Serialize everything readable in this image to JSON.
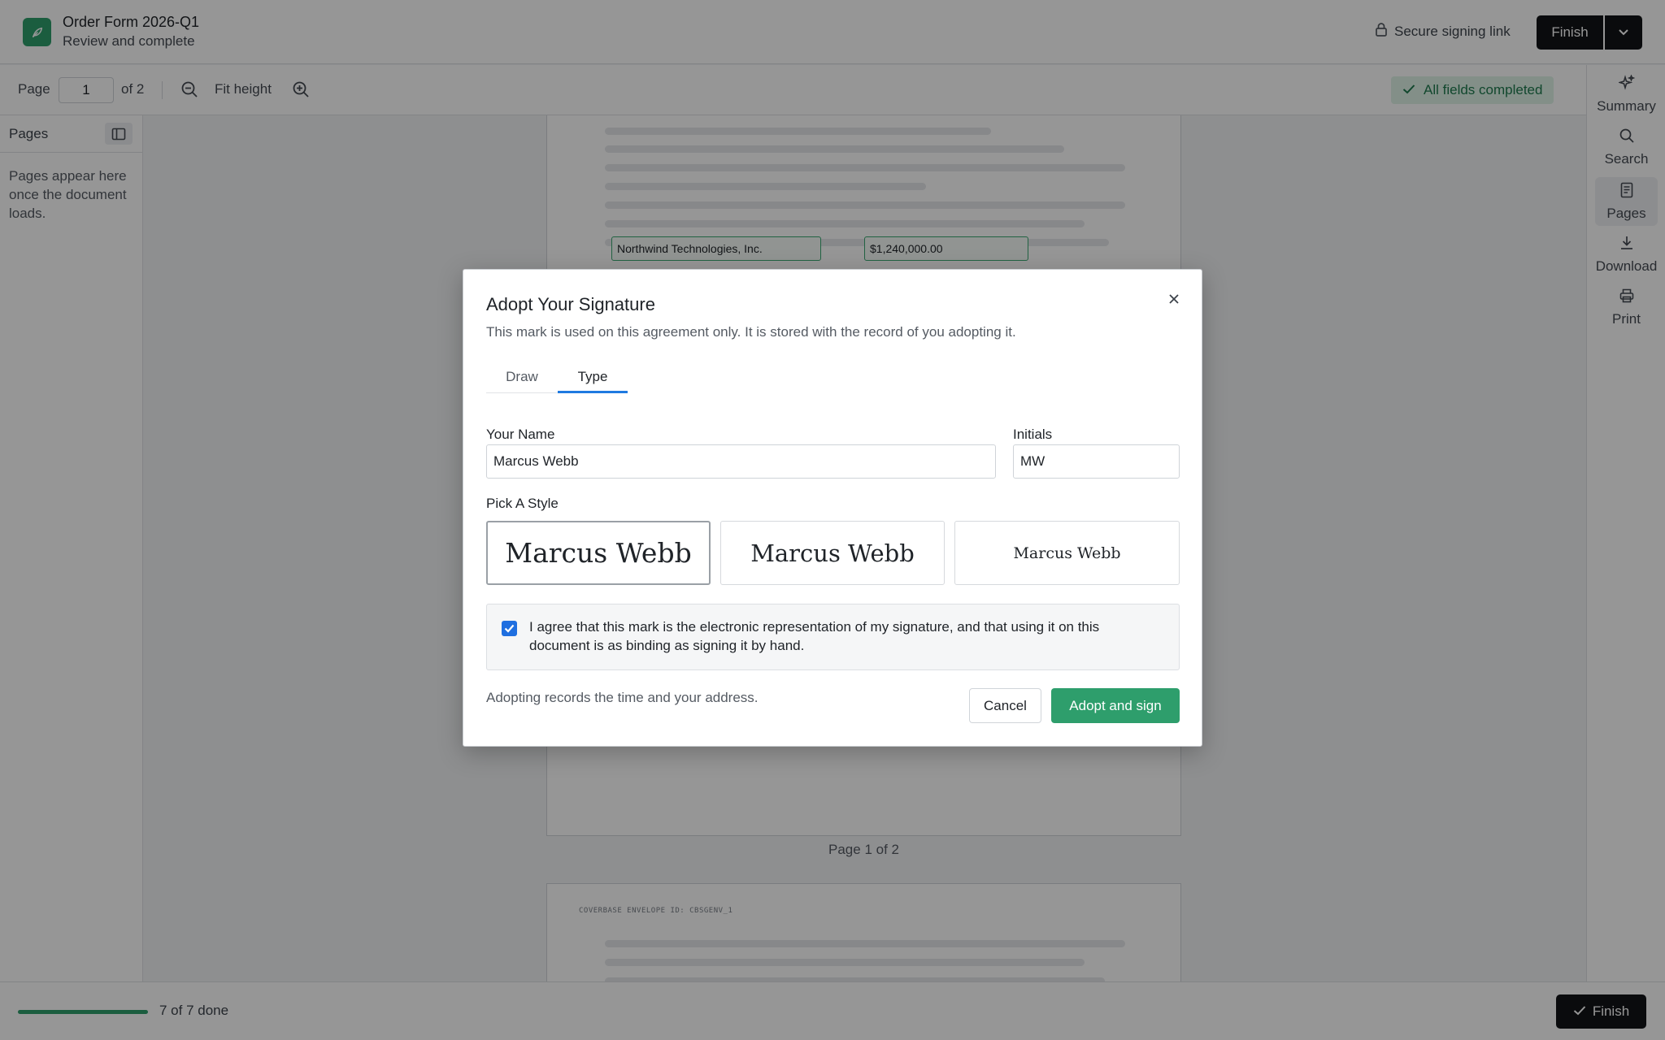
{
  "header": {
    "doc_title": "Order Form 2026-Q1",
    "doc_subtitle": "Review and complete",
    "secure_label": "Secure signing link",
    "finish_label": "Finish",
    "logo_icon": "leaf-icon",
    "brand_color": "#2e9e6c"
  },
  "toolbar": {
    "page_label": "Page",
    "page_value": "1",
    "page_of": "of 2",
    "zoom_label": "Fit height",
    "status": "All fields completed",
    "status_color": "#1d7a4d"
  },
  "rail": {
    "items": [
      {
        "label": "Summary",
        "icon": "sparkle-icon"
      },
      {
        "label": "Search",
        "icon": "search-icon"
      },
      {
        "label": "Pages",
        "icon": "page-icon",
        "active": true
      },
      {
        "label": "Download",
        "icon": "download-icon"
      },
      {
        "label": "Print",
        "icon": "printer-icon"
      }
    ]
  },
  "left_panel": {
    "title": "Pages",
    "empty_text": "Pages appear here once the document loads."
  },
  "document": {
    "fields": [
      "Northwind Technologies, Inc.",
      "$1,240,000.00"
    ],
    "page_caption": "Page 1 of 2",
    "envelope_id": "COVERBASE ENVELOPE ID: CBSGENV_1"
  },
  "bottom": {
    "progress_text": "7 of 7 done",
    "progress_fraction": 1.0,
    "finish_label": "Finish"
  },
  "modal": {
    "title": "Adopt Your Signature",
    "subtitle": "This mark is used on this agreement only. It is stored with the record of you adopting it.",
    "tabs": [
      "Draw",
      "Type"
    ],
    "active_tab": "Type",
    "name_label": "Your Name",
    "name_value": "Marcus Webb",
    "initials_label": "Initials",
    "initials_value": "MW",
    "style_label": "Pick A Style",
    "styles": [
      "Marcus Webb",
      "Marcus Webb",
      "Marcus Webb"
    ],
    "selected_style": 0,
    "consent_checked": true,
    "consent_text": "I agree that this mark is the electronic representation of my signature, and that using it on this document is as binding as signing it by hand.",
    "footer_note": "Adopting records the time and your address.",
    "cancel_label": "Cancel",
    "adopt_label": "Adopt and sign",
    "accent_color": "#1f7ae0"
  }
}
